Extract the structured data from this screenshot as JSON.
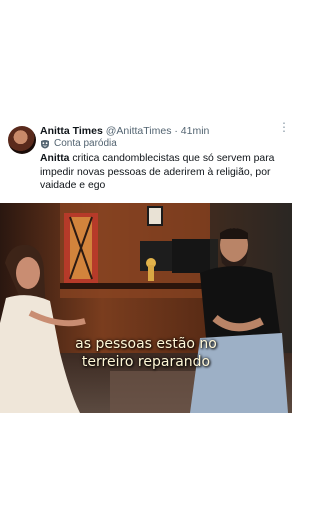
{
  "tweet": {
    "display_name": "Anitta Times",
    "handle": "@AnittaTimes",
    "separator": "·",
    "time": "41min",
    "parody_label": "Conta paródia",
    "more_icon": "more-dots-icon",
    "text_bold": "Anitta",
    "text_rest": " critica candomblecistas que só servem para impedir novas pessoas de aderirem à religião, por vaidade e ego"
  },
  "video": {
    "caption_line1": "as pessoas estão no",
    "caption_line2": "terreiro reparando"
  }
}
